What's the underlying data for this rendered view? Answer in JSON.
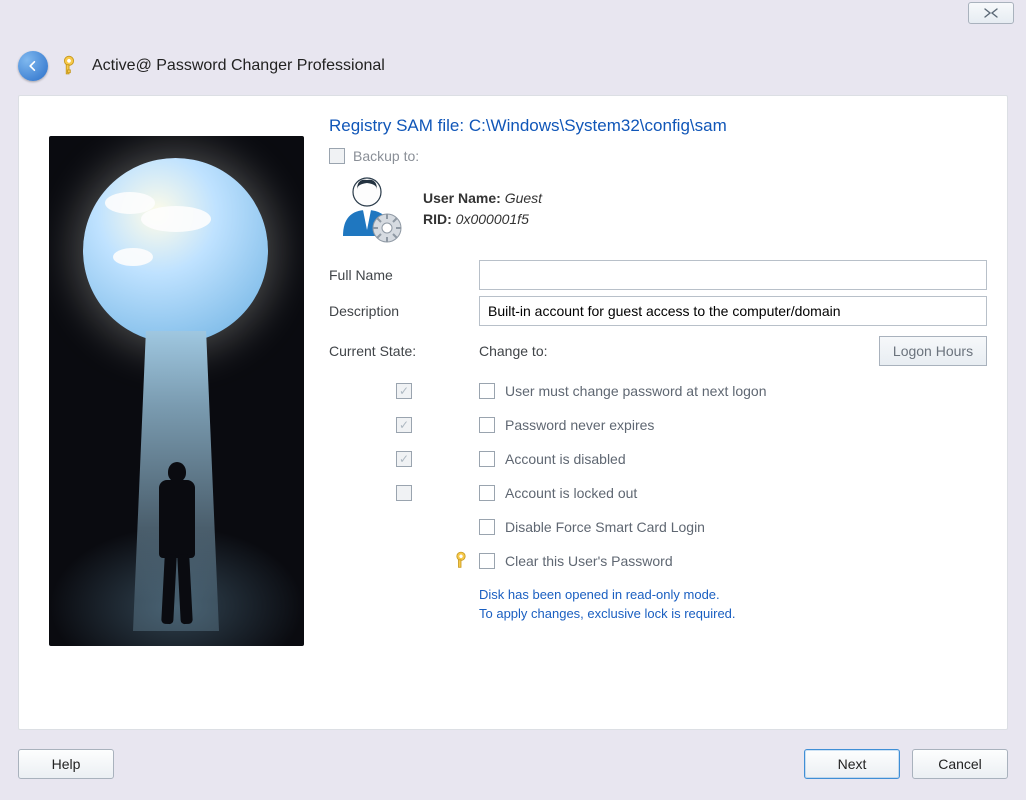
{
  "window": {
    "title": "Active@ Password Changer Professional"
  },
  "main": {
    "sam_prefix": "Registry SAM file: ",
    "sam_path": "C:\\Windows\\System32\\config\\sam",
    "backup_label": "Backup to:",
    "user": {
      "name_label": "User Name:",
      "name_value": "Guest",
      "rid_label": "RID:",
      "rid_value": "0x000001f5"
    },
    "fields": {
      "full_name_label": "Full Name",
      "full_name_value": "",
      "description_label": "Description",
      "description_value": "Built-in account for guest access to the computer/domain"
    },
    "state": {
      "current_label": "Current State:",
      "change_label": "Change to:",
      "logon_hours_label": "Logon Hours",
      "options": [
        {
          "current_checked": true,
          "label": "User must change password at next logon"
        },
        {
          "current_checked": true,
          "label": "Password never expires"
        },
        {
          "current_checked": true,
          "label": "Account is disabled"
        },
        {
          "current_checked": false,
          "label": "Account is locked out"
        },
        {
          "current_checked": null,
          "label": "Disable Force Smart Card Login"
        },
        {
          "current_checked": null,
          "label": "Clear this User's Password",
          "key_icon": true
        }
      ]
    },
    "warning_line1": "Disk has been opened in read-only mode.",
    "warning_line2": "To apply changes, exclusive lock is required."
  },
  "footer": {
    "help": "Help",
    "next": "Next",
    "cancel": "Cancel"
  }
}
